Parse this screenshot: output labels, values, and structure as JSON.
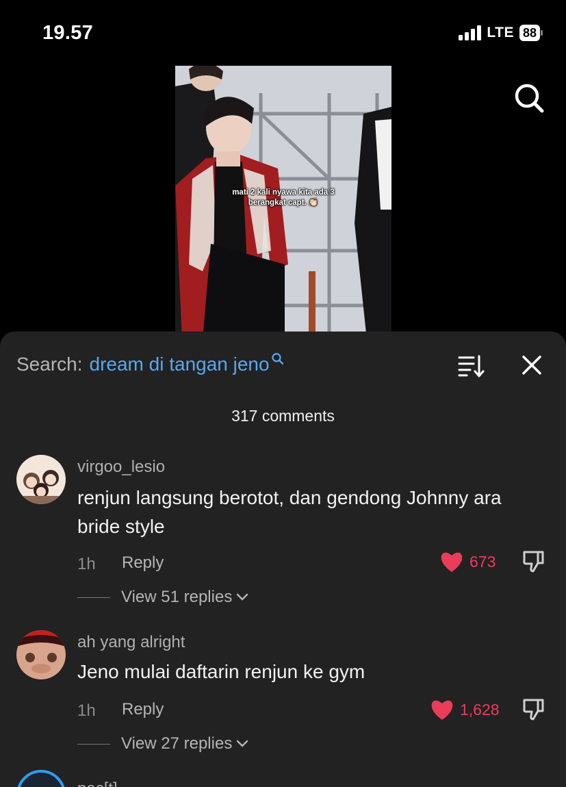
{
  "status_bar": {
    "time": "19.57",
    "network": "LTE",
    "battery": "88"
  },
  "video": {
    "caption_line1": "mati 2 kali nyawa kita ada 3",
    "caption_line2": "berangkat capt. 👏🏻"
  },
  "comments_panel": {
    "search_label": "Search:",
    "search_query": "dream di tangan jeno",
    "comment_count": "317 comments"
  },
  "comments": [
    {
      "username": "virgoo_lesio",
      "text": "renjun langsung berotot, dan gendong Johnny ara bride style",
      "time": "1h",
      "reply_label": "Reply",
      "likes": "673",
      "view_replies": "View 51 replies"
    },
    {
      "username": "ah yang alright",
      "text": "Jeno mulai daftarin renjun ke gym",
      "time": "1h",
      "reply_label": "Reply",
      "likes": "1,628",
      "view_replies": "View 27 replies"
    },
    {
      "username": "pac[t]"
    }
  ],
  "colors": {
    "accent_blue": "#5aa7f0",
    "like_red": "#ea3d5a",
    "sheet_bg": "#222222"
  }
}
